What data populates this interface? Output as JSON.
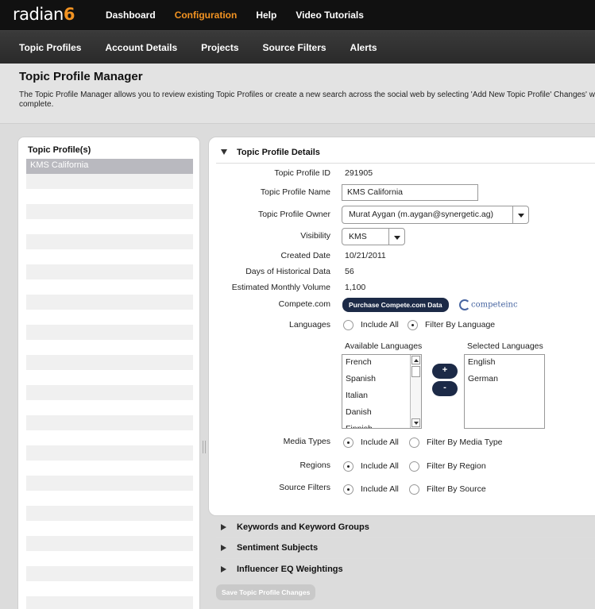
{
  "brand": {
    "name": "radian",
    "mark": "6"
  },
  "top_nav": [
    {
      "label": "Dashboard",
      "active": false
    },
    {
      "label": "Configuration",
      "active": true
    },
    {
      "label": "Help",
      "active": false
    },
    {
      "label": "Video Tutorials",
      "active": false
    }
  ],
  "sub_nav": [
    "Topic Profiles",
    "Account Details",
    "Projects",
    "Source Filters",
    "Alerts"
  ],
  "page": {
    "title": "Topic Profile Manager",
    "description": "The Topic Profile Manager allows you to review existing Topic Profiles or create a new search across the social web by selecting 'Add New Topic Profile' Changes' when complete."
  },
  "topic_list": {
    "title": "Topic Profile(s)",
    "items": [
      "KMS California"
    ]
  },
  "details": {
    "section_title": "Topic Profile Details",
    "fields": {
      "id_label": "Topic Profile ID",
      "id_value": "291905",
      "name_label": "Topic Profile Name",
      "name_value": "KMS California",
      "owner_label": "Topic Profile Owner",
      "owner_value": "Murat Aygan (m.aygan@synergetic.ag)",
      "visibility_label": "Visibility",
      "visibility_value": "KMS",
      "created_label": "Created Date",
      "created_value": "10/21/2011",
      "hist_label": "Days of Historical Data",
      "hist_value": "56",
      "volume_label": "Estimated Monthly Volume",
      "volume_value": "1,100",
      "compete_label": "Compete.com",
      "compete_button": "Purchase Compete.com Data",
      "compete_logo": "competeinc",
      "languages_label": "Languages",
      "lang_include_all": "Include All",
      "lang_filter": "Filter By Language",
      "available_label": "Available Languages",
      "selected_label": "Selected Languages",
      "media_label": "Media Types",
      "media_include_all": "Include All",
      "media_filter": "Filter By Media Type",
      "regions_label": "Regions",
      "regions_include_all": "Include All",
      "regions_filter": "Filter By Region",
      "source_label": "Source Filters",
      "source_include_all": "Include All",
      "source_filter": "Filter By Source"
    },
    "available_languages": [
      "French",
      "Spanish",
      "Italian",
      "Danish",
      "Finnish"
    ],
    "selected_languages": [
      "English",
      "German"
    ],
    "add_button": "+",
    "remove_button": "-"
  },
  "collapsed_sections": [
    "Keywords and Keyword Groups",
    "Sentiment Subjects",
    "Influencer EQ Weightings"
  ],
  "save_button": "Save Topic Profile Changes",
  "colors": {
    "accent": "#f29322",
    "nav_bg": "#111111",
    "button_dark": "#1c2a47"
  }
}
